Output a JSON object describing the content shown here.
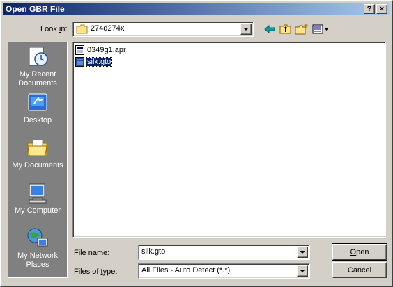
{
  "window": {
    "title": "Open GBR File",
    "help_label": "?",
    "close_label": "×"
  },
  "lookin": {
    "label_pre": "Look ",
    "label_key": "i",
    "label_post": "n:",
    "value": "274d274x"
  },
  "toolbar": {
    "icons": [
      "back-icon",
      "up-folder-icon",
      "new-folder-icon",
      "view-menu-icon"
    ]
  },
  "places": [
    {
      "name": "recent",
      "label": "My Recent Documents",
      "icon": "recent-documents-icon"
    },
    {
      "name": "desktop",
      "label": "Desktop",
      "icon": "desktop-icon"
    },
    {
      "name": "documents",
      "label": "My Documents",
      "icon": "my-documents-icon"
    },
    {
      "name": "computer",
      "label": "My Computer",
      "icon": "my-computer-icon"
    },
    {
      "name": "network",
      "label": "My Network Places",
      "icon": "network-places-icon"
    }
  ],
  "files": [
    {
      "name": "0349g1.apr",
      "selected": false
    },
    {
      "name": "silk.gto",
      "selected": true
    }
  ],
  "filename": {
    "label_pre": "File ",
    "label_key": "n",
    "label_post": "ame:",
    "value": "silk.gto"
  },
  "filetype": {
    "label_pre": "Files of ",
    "label_key": "t",
    "label_post": "ype:",
    "value": "All Files - Auto Detect (*.*)"
  },
  "buttons": {
    "open_key": "O",
    "open_rest": "pen",
    "cancel": "Cancel"
  },
  "colors": {
    "titlebar_start": "#0a246a",
    "titlebar_end": "#a6caf0",
    "face": "#d4d0c8",
    "places_bg": "#808080",
    "selection": "#0a246a"
  }
}
